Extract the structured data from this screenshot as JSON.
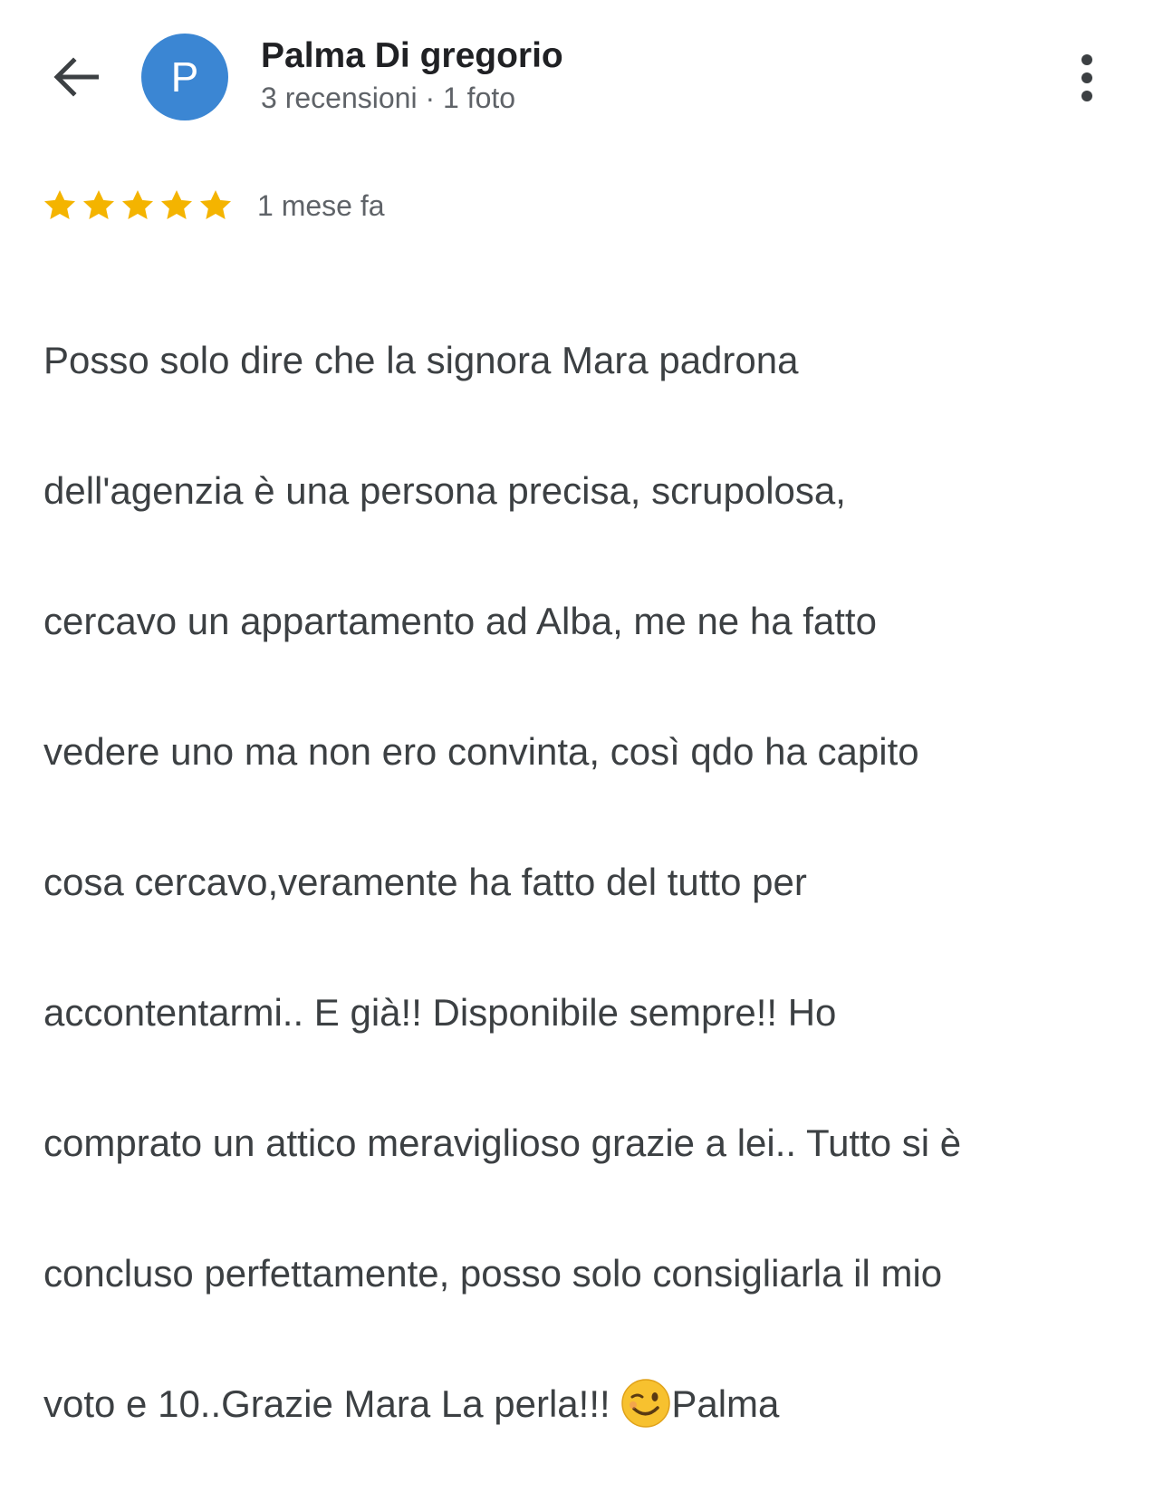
{
  "header": {
    "back_icon": "arrow-left-icon",
    "avatar_initial": "P",
    "avatar_color": "#3b86d3",
    "name": "Palma Di gregorio",
    "subtitle": "3 recensioni · 1 foto",
    "more_icon": "more-vertical-icon"
  },
  "review": {
    "rating": 5,
    "rating_max": 5,
    "star_color": "#f4b400",
    "time_ago": "1 mese fa",
    "lines": [
      "Posso solo dire che la signora Mara padrona",
      "dell'agenzia è una persona precisa, scrupolosa,",
      "cercavo un appartamento ad Alba, me ne ha fatto",
      "vedere uno ma non ero convinta, così qdo ha capito",
      "cosa cercavo,veramente ha fatto del tutto per",
      "accontentarmi.. E già!! Disponibile sempre!! Ho",
      "comprato un attico meraviglioso grazie a lei.. Tutto si è",
      "concluso perfettamente, posso solo consigliarla il mio"
    ],
    "last_line_before_emoji": "voto e 10..Grazie Mara La perla!!! ",
    "emoji": "winking-face-emoji",
    "last_line_after_emoji": "Palma"
  }
}
